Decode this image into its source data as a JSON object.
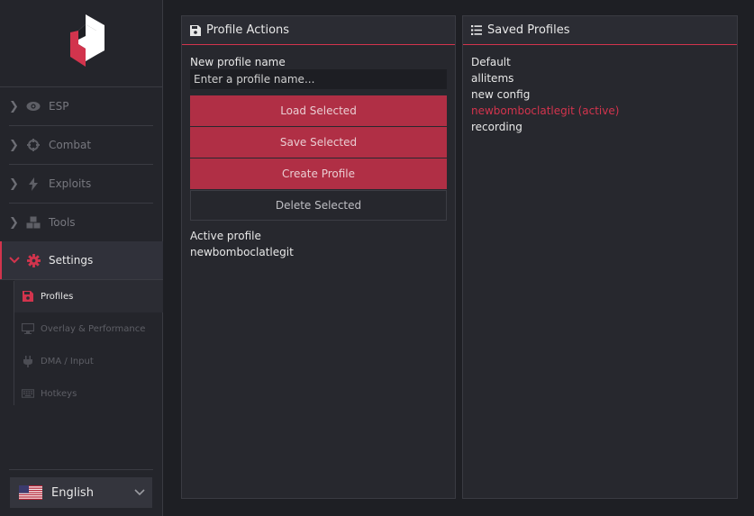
{
  "sidebar": {
    "items": [
      {
        "label": "ESP",
        "icon": "eye-icon"
      },
      {
        "label": "Combat",
        "icon": "crosshair-icon"
      },
      {
        "label": "Exploits",
        "icon": "bolt-icon"
      },
      {
        "label": "Tools",
        "icon": "cubes-icon"
      },
      {
        "label": "Settings",
        "icon": "gear-icon"
      }
    ],
    "sub_items": [
      {
        "label": "Profiles",
        "icon": "save-icon"
      },
      {
        "label": "Overlay & Performance",
        "icon": "monitor-icon"
      },
      {
        "label": "DMA / Input",
        "icon": "plug-icon"
      },
      {
        "label": "Hotkeys",
        "icon": "keyboard-icon"
      }
    ],
    "language": "English"
  },
  "actions_panel": {
    "title": "Profile Actions",
    "new_profile_label": "New profile name",
    "input_placeholder": "Enter a profile name...",
    "input_value": "",
    "buttons": {
      "load": "Load Selected",
      "save": "Save Selected",
      "create": "Create Profile",
      "delete": "Delete Selected"
    },
    "active_profile_label": "Active profile",
    "active_profile_value": "newbomboclatlegit"
  },
  "saved_panel": {
    "title": "Saved Profiles",
    "profiles": [
      {
        "name": "Default"
      },
      {
        "name": "allitems"
      },
      {
        "name": "new config"
      },
      {
        "name": "newbomboclatlegit  (active)"
      },
      {
        "name": "recording"
      }
    ]
  },
  "colors": {
    "accent": "#d2344d",
    "button_primary": "#b02f45",
    "background": "#1e1f24",
    "panel": "#27282e"
  }
}
